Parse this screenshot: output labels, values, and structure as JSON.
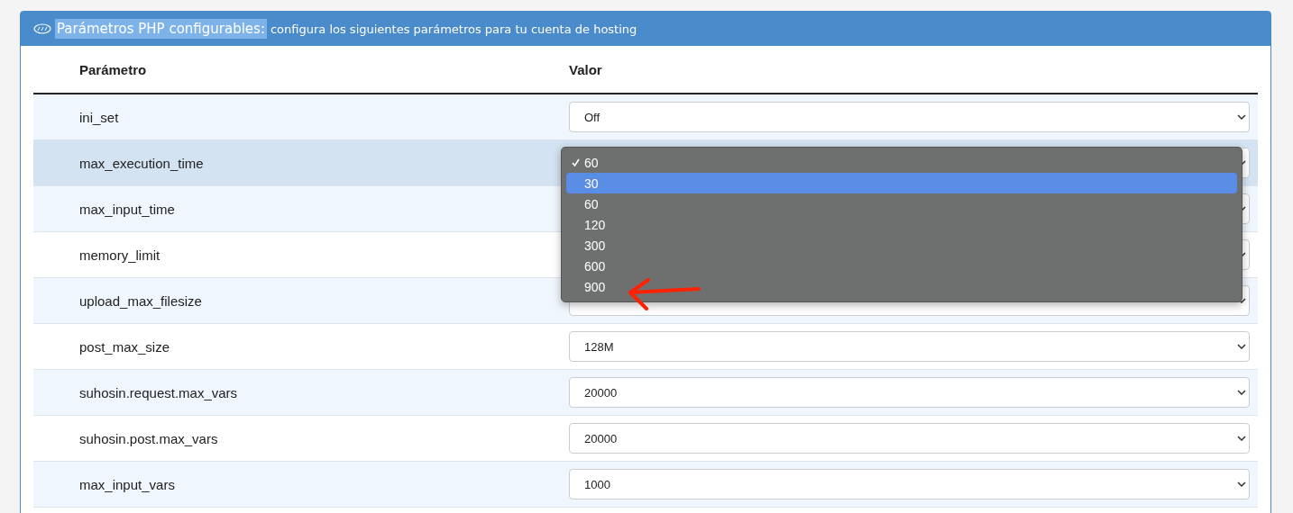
{
  "panel": {
    "title": {
      "text": "Parámetros PHP configurables:",
      "highlighted": true
    },
    "subtitle": "configura los siguientes parámetros para tu cuenta de hosting"
  },
  "table": {
    "columns": [
      "Parámetro",
      "Valor"
    ],
    "rows": [
      {
        "name": "ini_set",
        "value": "Off",
        "hovered": false
      },
      {
        "name": "max_execution_time",
        "hovered": true,
        "dropdown_open": true
      },
      {
        "name": "max_input_time",
        "hovered": false
      },
      {
        "name": "memory_limit",
        "hovered": false
      },
      {
        "name": "upload_max_filesize",
        "hovered": false
      },
      {
        "name": "post_max_size",
        "value": "128M",
        "hovered": false
      },
      {
        "name": "suhosin.request.max_vars",
        "value": "20000",
        "hovered": false
      },
      {
        "name": "suhosin.post.max_vars",
        "value": "20000",
        "hovered": false
      },
      {
        "name": "max_input_vars",
        "value": "1000",
        "hovered": false
      }
    ]
  },
  "dropdown": {
    "options": [
      {
        "label": "60",
        "checked": true,
        "selected": false
      },
      {
        "label": "30",
        "checked": false,
        "selected": true
      },
      {
        "label": "60",
        "checked": false,
        "selected": false
      },
      {
        "label": "120",
        "checked": false,
        "selected": false
      },
      {
        "label": "300",
        "checked": false,
        "selected": false
      },
      {
        "label": "600",
        "checked": false,
        "selected": false
      },
      {
        "label": "900",
        "checked": false,
        "selected": false
      }
    ]
  }
}
